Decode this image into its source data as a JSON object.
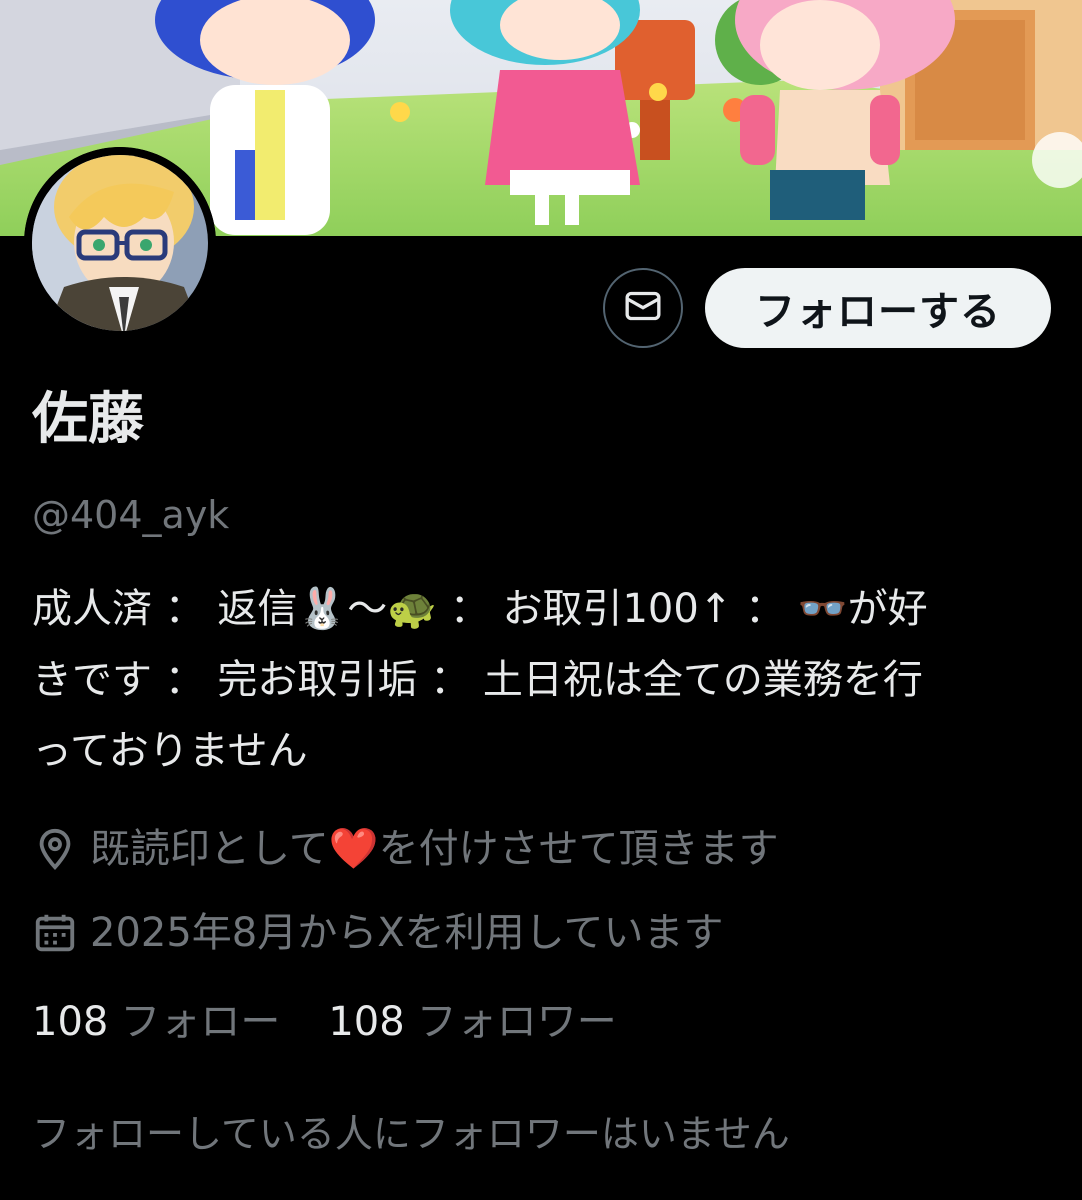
{
  "profile": {
    "display_name": "佐藤",
    "handle": "@404_ayk",
    "bio_lines": [
      "成人済 ： 返信🐰〜🐢 ： お取引100↑ ： 👓が好",
      "きです ： 完お取引垢 ： 土日祝は全ての業務を行",
      "っておりません"
    ],
    "location": "既読印として❤️を付けさせて頂きます",
    "joined": "2025年8月からXを利用しています"
  },
  "actions": {
    "follow_label": "フォローする",
    "dm_icon": "mail-icon"
  },
  "stats": {
    "following_count": "108",
    "following_label": "フォロー",
    "followers_count": "108",
    "followers_label": "フォロワー"
  },
  "followers_you_know": "フォローしている人にフォロワーはいません",
  "colors": {
    "background": "#000000",
    "primary_text": "#e7e9ea",
    "secondary_text": "#71767b",
    "follow_button_bg": "#eff3f4",
    "border": "#536471"
  },
  "icons": {
    "location": "location-pin-icon",
    "joined": "calendar-icon"
  }
}
